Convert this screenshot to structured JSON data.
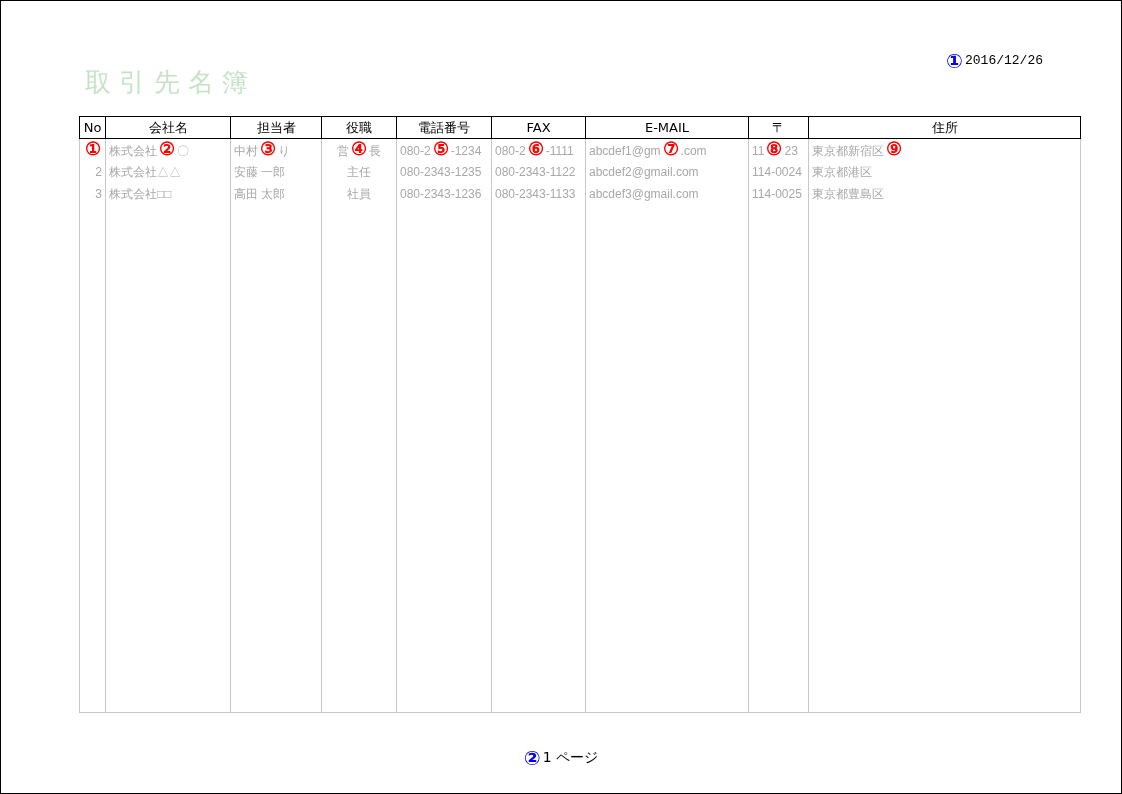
{
  "title": "取 引 先 名 簿",
  "date": {
    "marker": {
      "text": "①",
      "color": "#0000ff"
    },
    "text": "2016/12/26"
  },
  "columns": [
    {
      "label": "No"
    },
    {
      "label": "会社名"
    },
    {
      "label": "担当者"
    },
    {
      "label": "役職"
    },
    {
      "label": "電話番号"
    },
    {
      "label": "FAX"
    },
    {
      "label": "E-MAIL"
    },
    {
      "label": "〒"
    },
    {
      "label": "住所"
    }
  ],
  "rows": [
    [
      {
        "marker": {
          "text": "①",
          "color": "#ff0000"
        }
      },
      {
        "before": "株式会社",
        "marker": {
          "text": "②",
          "color": "#ff0000"
        },
        "after": "〇"
      },
      {
        "before": "中村",
        "marker": {
          "text": "③",
          "color": "#ff0000"
        },
        "after": "り"
      },
      {
        "before": "営",
        "marker": {
          "text": "④",
          "color": "#ff0000"
        },
        "after": "長"
      },
      {
        "before": "080-2",
        "marker": {
          "text": "⑤",
          "color": "#ff0000"
        },
        "after": "-1234"
      },
      {
        "before": "080-2",
        "marker": {
          "text": "⑥",
          "color": "#ff0000"
        },
        "after": "-1111"
      },
      {
        "before": "abcdef1@gm",
        "marker": {
          "text": "⑦",
          "color": "#ff0000"
        },
        "after": ".com"
      },
      {
        "before": "11",
        "marker": {
          "text": "⑧",
          "color": "#ff0000"
        },
        "after": "23"
      },
      {
        "before": "東京都新宿区",
        "marker": {
          "text": "⑨",
          "color": "#ff0000"
        }
      }
    ],
    [
      {
        "before": "2"
      },
      {
        "before": "株式会社△△"
      },
      {
        "before": "安藤 一郎"
      },
      {
        "before": "主任"
      },
      {
        "before": "080-2343-1235"
      },
      {
        "before": "080-2343-1122"
      },
      {
        "before": "abcdef2@gmail.com"
      },
      {
        "before": "114-0024"
      },
      {
        "before": "東京都港区"
      }
    ],
    [
      {
        "before": "3"
      },
      {
        "before": "株式会社□□"
      },
      {
        "before": "高田 太郎"
      },
      {
        "before": "社員"
      },
      {
        "before": "080-2343-1236"
      },
      {
        "before": "080-2343-1133"
      },
      {
        "before": "abcdef3@gmail.com"
      },
      {
        "before": "114-0025"
      },
      {
        "before": "東京都豊島区"
      }
    ]
  ],
  "footer": {
    "marker": {
      "text": "②",
      "color": "#0000ff"
    },
    "text": "1 ページ"
  }
}
